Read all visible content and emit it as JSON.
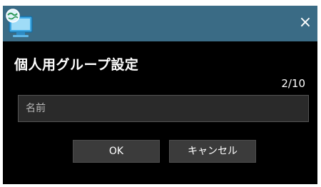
{
  "window": {
    "app_icon": "globe-computer-icon",
    "close_icon": "close-icon",
    "close_label": "×",
    "titlebar_color": "#3a6b85",
    "background_color": "#000000"
  },
  "dialog": {
    "title": "個人用グループ設定",
    "counter": "2/10",
    "name_field": {
      "value": "",
      "placeholder": "名前"
    },
    "ok_label": "OK",
    "cancel_label": "キャンセル"
  }
}
